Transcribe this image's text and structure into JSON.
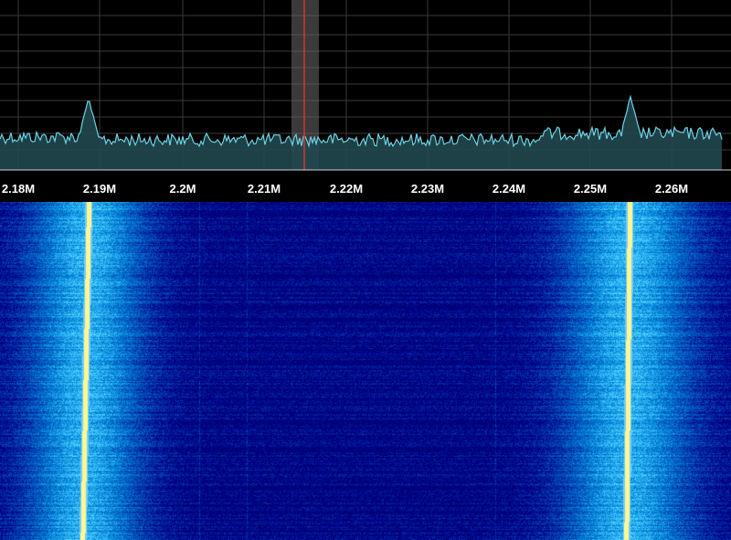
{
  "frequency_axis": {
    "ticks": [
      "2.18M",
      "2.19M",
      "2.2M",
      "2.21M",
      "2.22M",
      "2.23M",
      "2.24M",
      "2.25M",
      "2.26M"
    ]
  },
  "colors": {
    "trace": "#6fd3e6",
    "trace_fill": "#20484f",
    "grid": "#3a3a3a",
    "tuning_line": "#e03030",
    "tuning_band": "#6a6a6a",
    "waterfall_bg": "#00005a",
    "signal_core": "#fff8a0"
  },
  "icons": {
    "tuning_marker": "tuning-line-icon"
  }
}
